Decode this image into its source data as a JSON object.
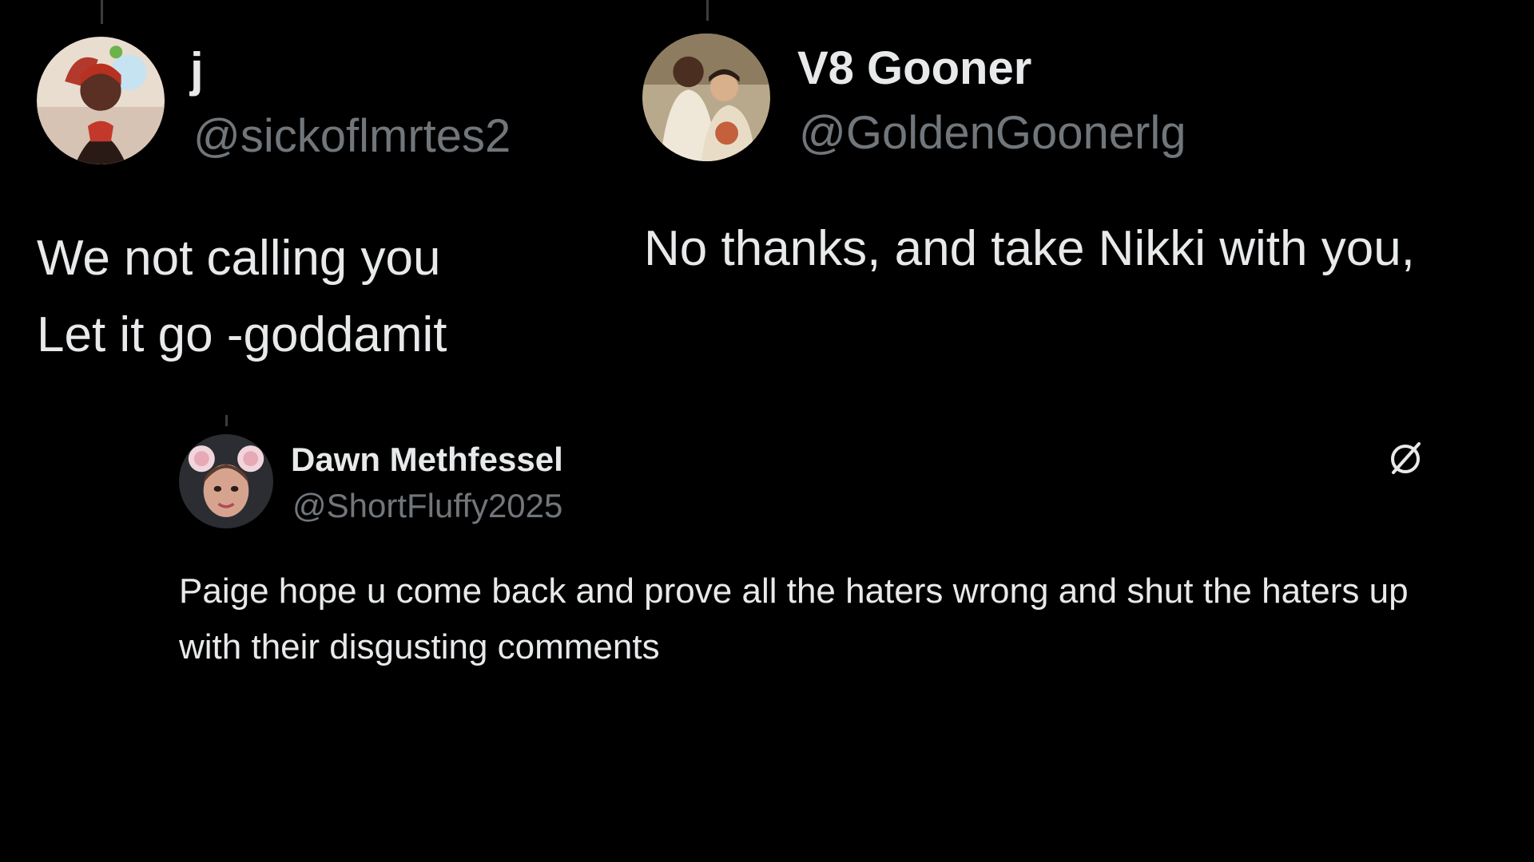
{
  "tweets": [
    {
      "name": "j",
      "handle": "@sickoflmrtes2",
      "body": "We not calling you\nLet it go  -goddamit"
    },
    {
      "name": "V8 Gooner",
      "handle": "@GoldenGoonerlg",
      "body": "No thanks, and take Nikki with you,"
    },
    {
      "name": "Dawn Methfessel",
      "handle": "@ShortFluffy2025",
      "body": "Paige hope u come back and prove all the haters wrong and shut the haters up with their disgusting comments"
    }
  ],
  "colors": {
    "background": "#000000",
    "text_primary": "#e7e9ea",
    "text_secondary": "#71767b",
    "thread_line": "#3a3d40"
  },
  "icons": {
    "menu": "grok-slash-icon"
  }
}
